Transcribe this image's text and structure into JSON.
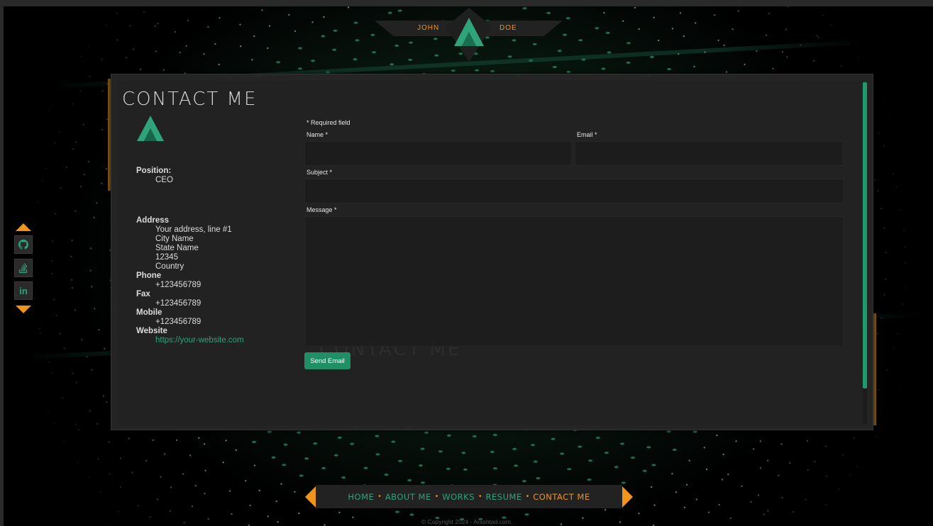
{
  "brand": {
    "first_name": "JOHN",
    "last_name": "DOE"
  },
  "page": {
    "title": "CONTACT ME"
  },
  "contact_info": {
    "position_label": "Position:",
    "position": "CEO",
    "address_label": "Address",
    "address_lines": [
      "Your address, line #1",
      "City Name",
      "State Name",
      "12345",
      "Country"
    ],
    "phone_label": "Phone",
    "phone": "+123456789",
    "fax_label": "Fax",
    "fax": "+123456789",
    "mobile_label": "Mobile",
    "mobile": "+123456789",
    "website_label": "Website",
    "website": "https://your-website.com"
  },
  "form": {
    "required_note": "* Required field",
    "name_label": "Name *",
    "email_label": "Email *",
    "subject_label": "Subject *",
    "message_label": "Message *",
    "name_value": "",
    "email_value": "",
    "subject_value": "",
    "message_value": "",
    "submit_label": "Send Email"
  },
  "social": [
    {
      "name": "github",
      "icon": "github-icon"
    },
    {
      "name": "stackoverflow",
      "icon": "stackoverflow-icon"
    },
    {
      "name": "linkedin",
      "icon": "linkedin-icon"
    }
  ],
  "nav": {
    "items": [
      "HOME",
      "ABOUT ME",
      "WORKS",
      "RESUME",
      "CONTACT ME"
    ],
    "active": "CONTACT ME"
  },
  "footer": {
    "copyright": "© Copyright 2024 - Arashtad.com."
  },
  "colors": {
    "accent_orange": "#f0941c",
    "accent_green": "#1f9a6c",
    "panel": "#262626"
  }
}
